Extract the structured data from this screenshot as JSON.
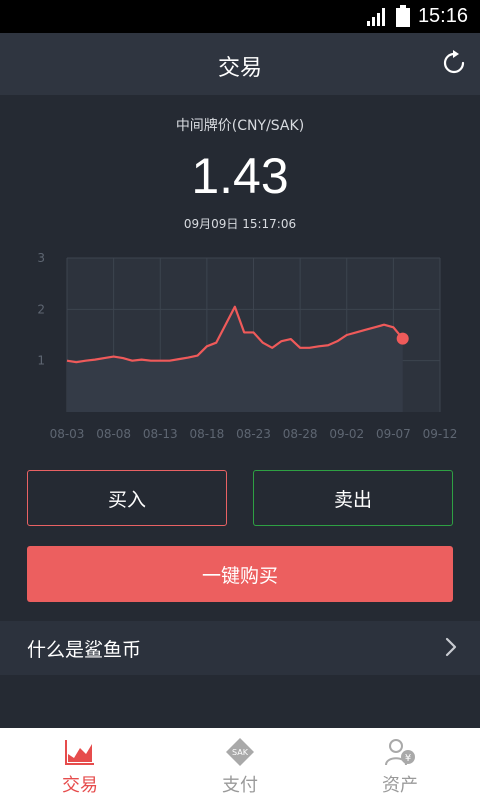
{
  "status_bar": {
    "time": "15:16"
  },
  "header": {
    "title": "交易",
    "refresh_icon": "refresh-icon"
  },
  "price": {
    "caption": "中间牌价(CNY/SAK)",
    "value": "1.43",
    "timestamp": "09月09日 15:17:06"
  },
  "chart_data": {
    "type": "area",
    "x_tick_labels": [
      "08-03",
      "08-08",
      "08-13",
      "08-18",
      "08-23",
      "08-28",
      "09-02",
      "09-07",
      "09-12"
    ],
    "y_tick_labels": [
      "3",
      "2",
      "1"
    ],
    "ylim": [
      0,
      3
    ],
    "grid": true,
    "series": [
      {
        "x": [
          "08-03",
          "08-04",
          "08-05",
          "08-06",
          "08-07",
          "08-08",
          "08-09",
          "08-10",
          "08-11",
          "08-12",
          "08-13",
          "08-14",
          "08-15",
          "08-16",
          "08-17",
          "08-18",
          "08-19",
          "08-20",
          "08-21",
          "08-22",
          "08-23",
          "08-24",
          "08-25",
          "08-26",
          "08-27",
          "08-28",
          "08-29",
          "08-30",
          "08-31",
          "09-01",
          "09-02",
          "09-03",
          "09-04",
          "09-05",
          "09-06",
          "09-07",
          "09-08"
        ],
        "values": [
          1.0,
          0.97,
          1.0,
          1.02,
          1.05,
          1.08,
          1.05,
          1.0,
          1.02,
          1.0,
          1.0,
          1.0,
          1.03,
          1.06,
          1.1,
          1.28,
          1.35,
          1.7,
          2.05,
          1.55,
          1.55,
          1.35,
          1.25,
          1.38,
          1.42,
          1.25,
          1.25,
          1.28,
          1.3,
          1.38,
          1.5,
          1.55,
          1.6,
          1.65,
          1.7,
          1.65,
          1.43
        ],
        "color": "#ef5a5a"
      }
    ]
  },
  "actions": {
    "buy_label": "买入",
    "sell_label": "卖出",
    "onekey_label": "一键购买",
    "buy_color": "#e96264",
    "sell_color": "#2ea043"
  },
  "info": {
    "label": "什么是鲨鱼币"
  },
  "tabs": [
    {
      "label": "交易",
      "icon": "chart-tab-icon",
      "active": true
    },
    {
      "label": "支付",
      "icon": "sak-coin-icon",
      "active": false,
      "badge": "SAK"
    },
    {
      "label": "资产",
      "icon": "user-asset-icon",
      "active": false,
      "badge": "¥"
    }
  ],
  "colors": {
    "accent": "#ec5f5f",
    "background": "#252a33",
    "header": "#2f3540"
  }
}
